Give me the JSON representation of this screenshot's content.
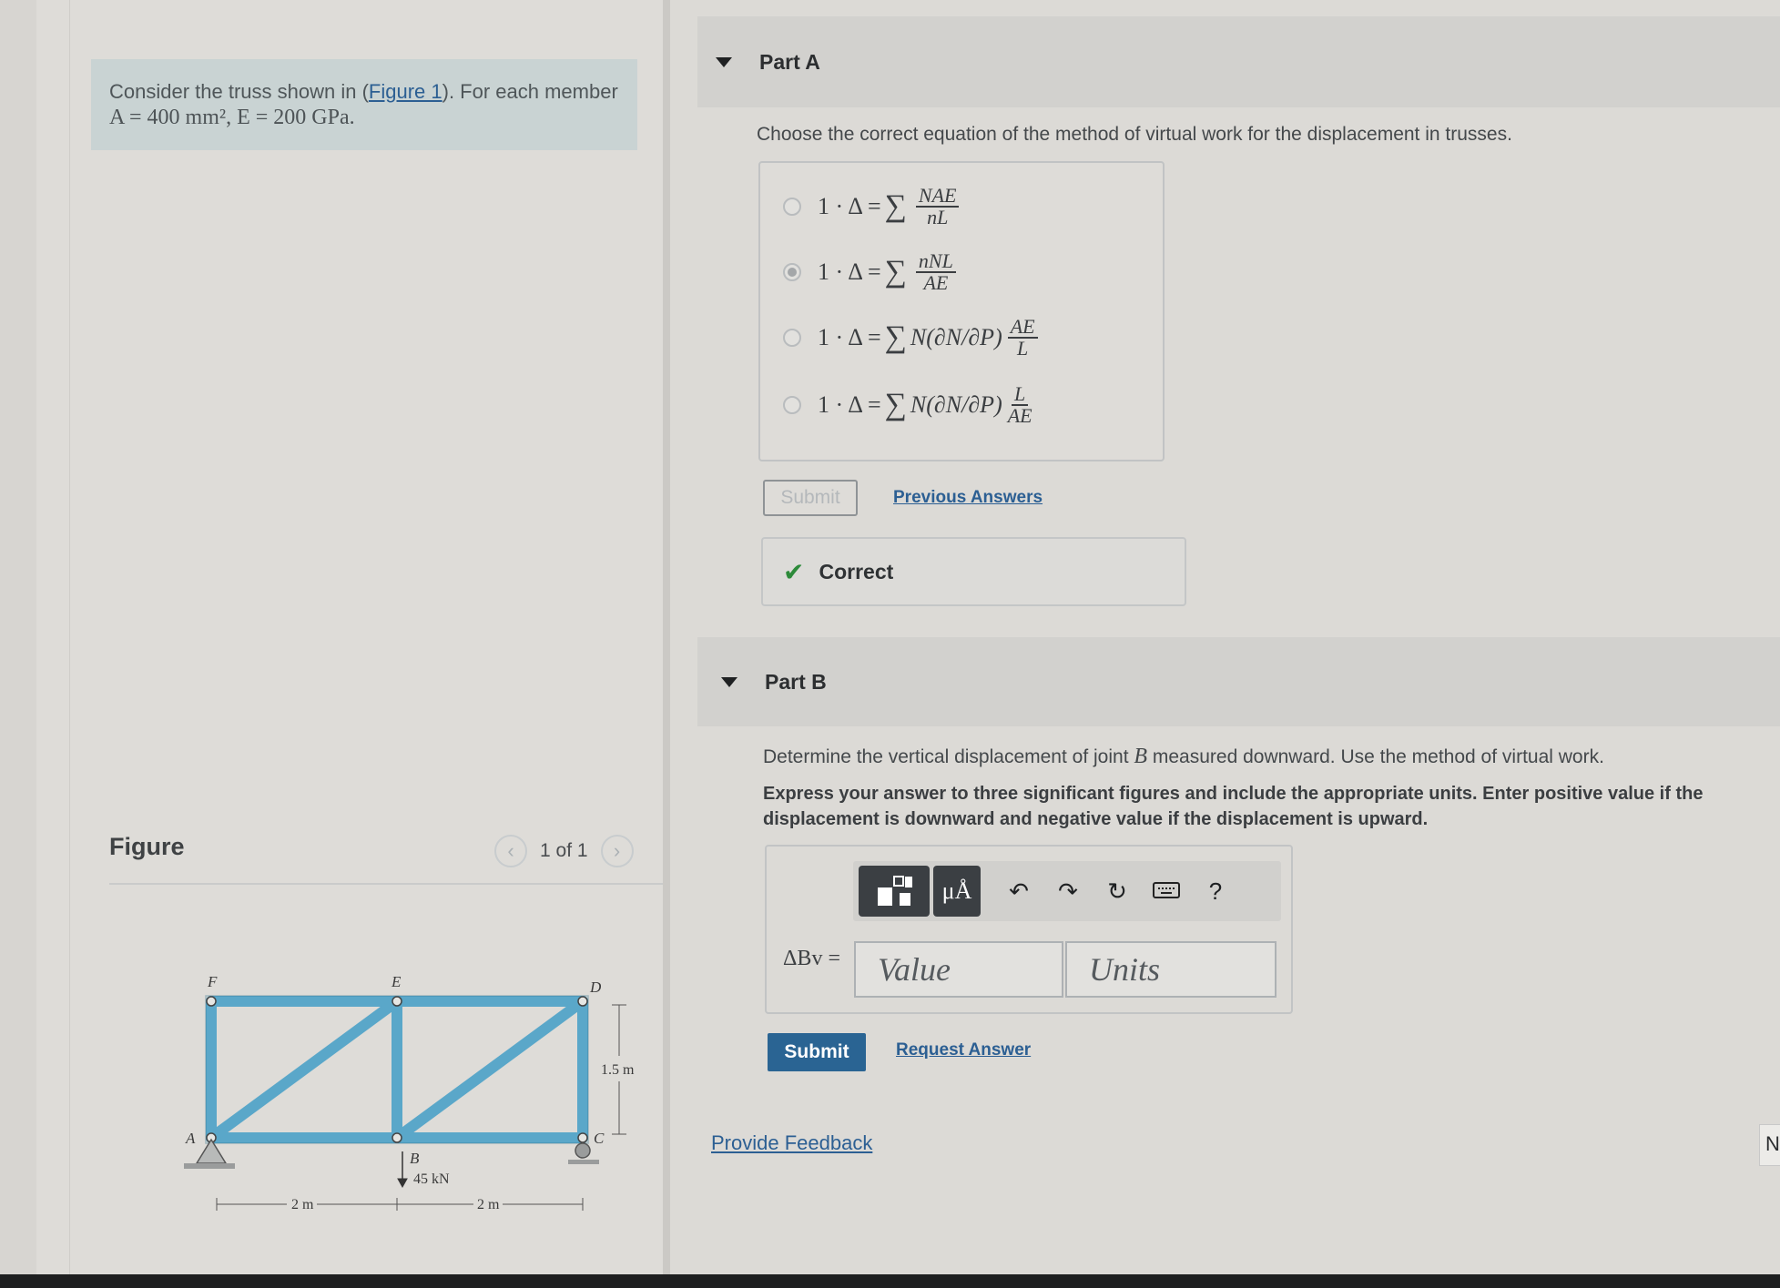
{
  "problem": {
    "text_prefix": "Consider the truss shown in (",
    "figure_link": "Figure 1",
    "text_suffix": "). For each member",
    "equation": "A = 400 mm², E = 200 GPa."
  },
  "figure": {
    "title": "Figure",
    "counter": "1 of 1",
    "prev_icon": "chevron-left-icon",
    "next_icon": "chevron-right-icon",
    "joint_labels": [
      "F",
      "E",
      "D",
      "A",
      "B",
      "C"
    ],
    "load_label": "45 kN",
    "dim_left": "2 m",
    "dim_right": "2 m",
    "dim_height": "1.5 m",
    "member_color": "#5aa7c9"
  },
  "part_a": {
    "header": "Part A",
    "instruction": "Choose the correct equation of the method of virtual work for the displacement in trusses.",
    "choices": [
      {
        "lhs": "1 · Δ = ",
        "num": "NAE",
        "den": "nL",
        "selected": false
      },
      {
        "lhs": "1 · Δ = ",
        "num": "nNL",
        "den": "AE",
        "selected": true
      },
      {
        "lhs": "1 · Δ = ",
        "mid": "N(∂N/∂P)",
        "num": "AE",
        "den": "L",
        "selected": false
      },
      {
        "lhs": "1 · Δ = ",
        "mid": "N(∂N/∂P)",
        "num": "L",
        "den": "AE",
        "selected": false
      }
    ],
    "submit_label": "Submit",
    "previous_answers": "Previous Answers",
    "feedback": "Correct"
  },
  "part_b": {
    "header": "Part B",
    "instruction_prefix": "Determine the vertical displacement of joint ",
    "instruction_joint": "B",
    "instruction_suffix": " measured downward. Use the method of virtual work.",
    "express": "Express your answer to three significant figures and include the appropriate units. Enter positive value if the displacement is downward and negative value if the displacement is upward.",
    "lhs_label": "ΔBv =",
    "value_placeholder": "Value",
    "units_placeholder": "Units",
    "toolbar": {
      "templates_icon": "templates-icon",
      "units_label": "μÅ",
      "undo_icon": "undo-icon",
      "redo_icon": "redo-icon",
      "reset_icon": "reset-icon",
      "keyboard_icon": "keyboard-icon",
      "help_label": "?"
    },
    "submit_label": "Submit",
    "request_answer": "Request Answer"
  },
  "provide_feedback": "Provide Feedback",
  "edge_tab": "N"
}
